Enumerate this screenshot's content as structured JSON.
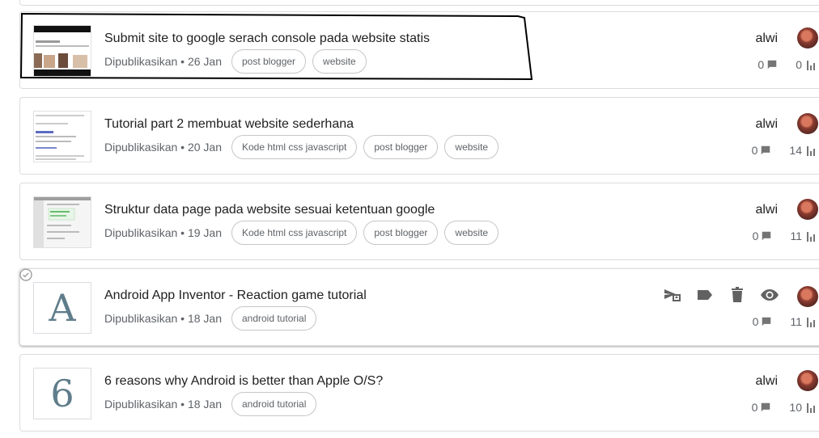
{
  "posts": [
    {
      "title": "Submit site to google serach console pada website statis",
      "published": "Dipublikasikan • 26 Jan",
      "labels": [
        "post blogger",
        "website"
      ],
      "author": "alwi",
      "comments": "0",
      "views": "0"
    },
    {
      "title": "Tutorial part 2 membuat website sederhana",
      "published": "Dipublikasikan • 20 Jan",
      "labels": [
        "Kode html css javascript",
        "post blogger",
        "website"
      ],
      "author": "alwi",
      "comments": "0",
      "views": "14"
    },
    {
      "title": "Struktur data page pada website sesuai ketentuan google",
      "published": "Dipublikasikan • 19 Jan",
      "labels": [
        "Kode html css javascript",
        "post blogger",
        "website"
      ],
      "author": "alwi",
      "comments": "0",
      "views": "11"
    },
    {
      "title": "Android App Inventor - Reaction game tutorial",
      "published": "Dipublikasikan • 18 Jan",
      "labels": [
        "android tutorial"
      ],
      "thumb_letter": "A",
      "comments": "0",
      "views": "11"
    },
    {
      "title": "6 reasons why Android is better than Apple O/S?",
      "published": "Dipublikasikan • 18 Jan",
      "labels": [
        "android tutorial"
      ],
      "thumb_letter": "6",
      "author": "alwi",
      "comments": "0",
      "views": "10"
    }
  ],
  "icons": {
    "comment": "comment-icon",
    "views": "stats-icon",
    "publish": "send-icon",
    "label": "label-icon",
    "delete": "delete-icon",
    "preview": "eye-icon",
    "select": "check-circle-icon"
  },
  "colors": {
    "icon": "#616161",
    "chip_border": "#c6c6c6",
    "letter": "#607d8b"
  }
}
